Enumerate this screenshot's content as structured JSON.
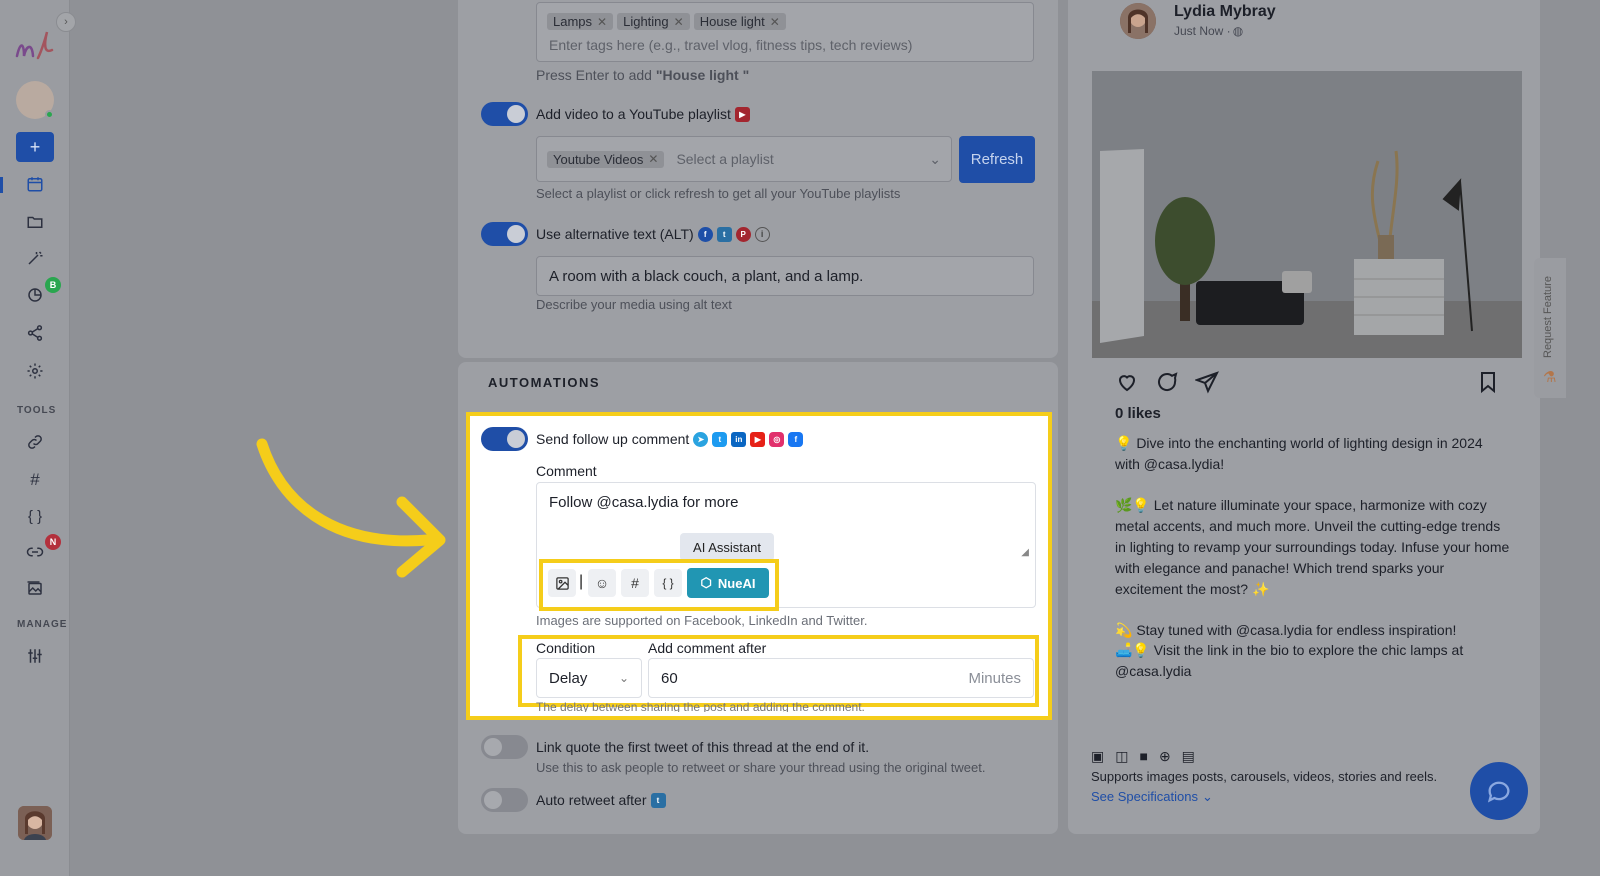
{
  "tags": {
    "items": [
      "Lamps",
      "Lighting",
      "House light"
    ],
    "placeholder": "Enter tags here (e.g., travel vlog, fitness tips, tech reviews)",
    "hint_prefix": "Press Enter to add ",
    "hint_value": "\"House light \""
  },
  "youtube_playlist": {
    "label": "Add video to a YouTube playlist",
    "selected_tag": "Youtube Videos",
    "placeholder": "Select a playlist",
    "refresh_label": "Refresh",
    "hint": "Select a playlist or click refresh to get all your YouTube playlists"
  },
  "alt_text": {
    "label": "Use alternative text (ALT)",
    "value": "A room with a black couch, a plant, and a lamp.",
    "hint": "Describe your media using alt text"
  },
  "automations": {
    "title": "AUTOMATIONS",
    "follow_up": {
      "label": "Send follow up comment",
      "comment_label": "Comment",
      "comment_value": "Follow @casa.lydia for more",
      "tooltip": "AI Assistant",
      "nueai_label": "NueAI",
      "images_hint": "Images are supported on Facebook, LinkedIn and Twitter.",
      "condition_label": "Condition",
      "condition_value": "Delay",
      "after_label": "Add comment after",
      "after_value": "60",
      "after_unit": "Minutes",
      "delay_hint": "The delay between sharing the post and adding the comment."
    },
    "link_quote": {
      "label": "Link quote the first tweet of this thread at the end of it.",
      "hint": "Use this to ask people to retweet or share your thread using the original tweet."
    },
    "auto_retweet": {
      "label": "Auto retweet after"
    }
  },
  "sidebar": {
    "tools_title": "TOOLS",
    "manage_title": "MANAGE",
    "badge_b": "B",
    "badge_n": "N",
    "collapse_icon": "chevron-right-icon"
  },
  "preview": {
    "user_name": "Lydia Mybray",
    "timestamp": "Just Now · ",
    "likes": "0 likes",
    "caption_1": "💡 Dive into the enchanting world of lighting design in 2024 with @casa.lydia!",
    "caption_2": "🌿💡 Let nature illuminate your space, harmonize with cozy metal accents, and much more. Unveil the cutting-edge trends in lighting to revamp your surroundings today. Infuse your home with elegance and panache! Which trend sparks your excitement the most? ✨",
    "caption_3": "💫 Stay tuned with @casa.lydia for endless inspiration!",
    "caption_4": "🛋️💡 Visit the link in the bio to explore the chic lamps at @casa.lydia",
    "supports_text": "Supports images posts, carousels, videos, stories and reels.",
    "specs_link": "See Specifications"
  },
  "request_feature": "Request Feature",
  "colors": {
    "accent": "#1f4ea7",
    "highlight": "#f5cd1a",
    "nueai": "#2196b3",
    "overlay": "#8f9196"
  }
}
